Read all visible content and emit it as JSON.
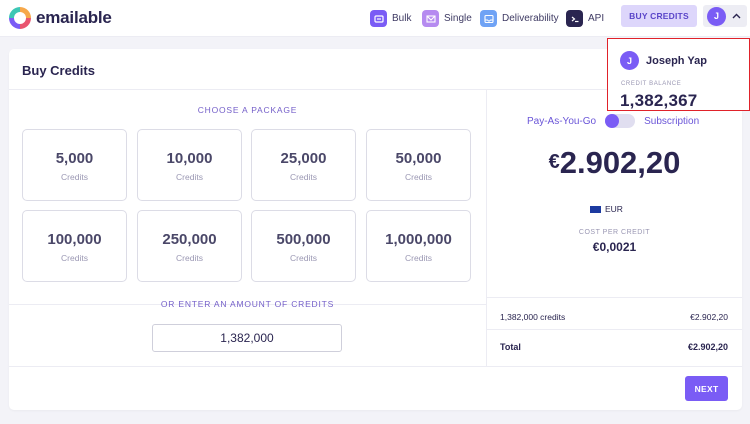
{
  "brand": {
    "name": "emailable"
  },
  "nav": {
    "items": [
      {
        "label": "Bulk",
        "icon": "bulk-icon",
        "color": "#7a5cf5"
      },
      {
        "label": "Single",
        "icon": "envelope-icon",
        "color": "#b68bf0"
      },
      {
        "label": "Deliverability",
        "icon": "inbox-icon",
        "color": "#6fa3f5"
      },
      {
        "label": "API",
        "icon": "terminal-icon",
        "color": "#2a2550"
      }
    ],
    "buy_credits_label": "BUY CREDITS",
    "user_initial": "J"
  },
  "dropdown": {
    "user_initial": "J",
    "user_name": "Joseph Yap",
    "balance_label": "CREDIT BALANCE",
    "balance_value": "1,382,367"
  },
  "card": {
    "title": "Buy Credits",
    "choose_label": "CHOOSE A PACKAGE",
    "packages": [
      {
        "amount": "5,000",
        "unit": "Credits"
      },
      {
        "amount": "10,000",
        "unit": "Credits"
      },
      {
        "amount": "25,000",
        "unit": "Credits"
      },
      {
        "amount": "50,000",
        "unit": "Credits"
      },
      {
        "amount": "100,000",
        "unit": "Credits"
      },
      {
        "amount": "250,000",
        "unit": "Credits"
      },
      {
        "amount": "500,000",
        "unit": "Credits"
      },
      {
        "amount": "1,000,000",
        "unit": "Credits"
      }
    ],
    "enter_label": "OR ENTER AN AMOUNT OF CREDITS",
    "amount_value": "1,382,000"
  },
  "pricing": {
    "payg_label": "Pay-As-You-Go",
    "subscription_label": "Subscription",
    "currency_symbol": "€",
    "total_price": "2.902,20",
    "currency_code": "EUR",
    "cpc_label": "COST PER CREDIT",
    "cpc_value": "€0,0021",
    "line_label": "1,382,000 credits",
    "line_value": "€2.902,20",
    "total_label": "Total",
    "total_value": "€2.902,20",
    "next_label": "NEXT",
    "accent_color": "#7a5cf5"
  }
}
